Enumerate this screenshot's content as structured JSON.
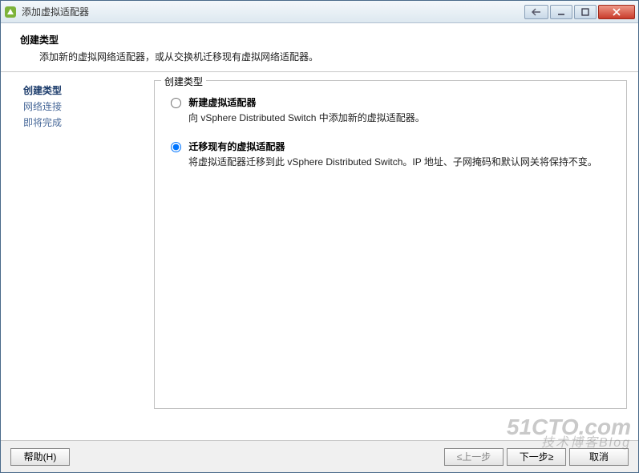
{
  "window": {
    "title": "添加虚拟适配器"
  },
  "header": {
    "title": "创建类型",
    "subtitle": "添加新的虚拟网络适配器，或从交换机迁移现有虚拟网络适配器。"
  },
  "sidebar": {
    "steps": [
      {
        "label": "创建类型",
        "state": "active"
      },
      {
        "label": "网络连接",
        "state": "link"
      },
      {
        "label": "即将完成",
        "state": "link"
      }
    ]
  },
  "group": {
    "legend": "创建类型",
    "options": [
      {
        "label": "新建虚拟适配器",
        "desc": "向 vSphere Distributed Switch 中添加新的虚拟适配器。",
        "checked": false
      },
      {
        "label": "迁移现有的虚拟适配器",
        "desc": "将虚拟适配器迁移到此 vSphere Distributed Switch。IP 地址、子网掩码和默认网关将保持不变。",
        "checked": true
      }
    ]
  },
  "footer": {
    "help": "帮助(H)",
    "back": "≤上一步",
    "next": "下一步≥",
    "cancel": "取消"
  },
  "watermark": {
    "main": "51CTO.com",
    "sub": "技术博客Blog"
  }
}
